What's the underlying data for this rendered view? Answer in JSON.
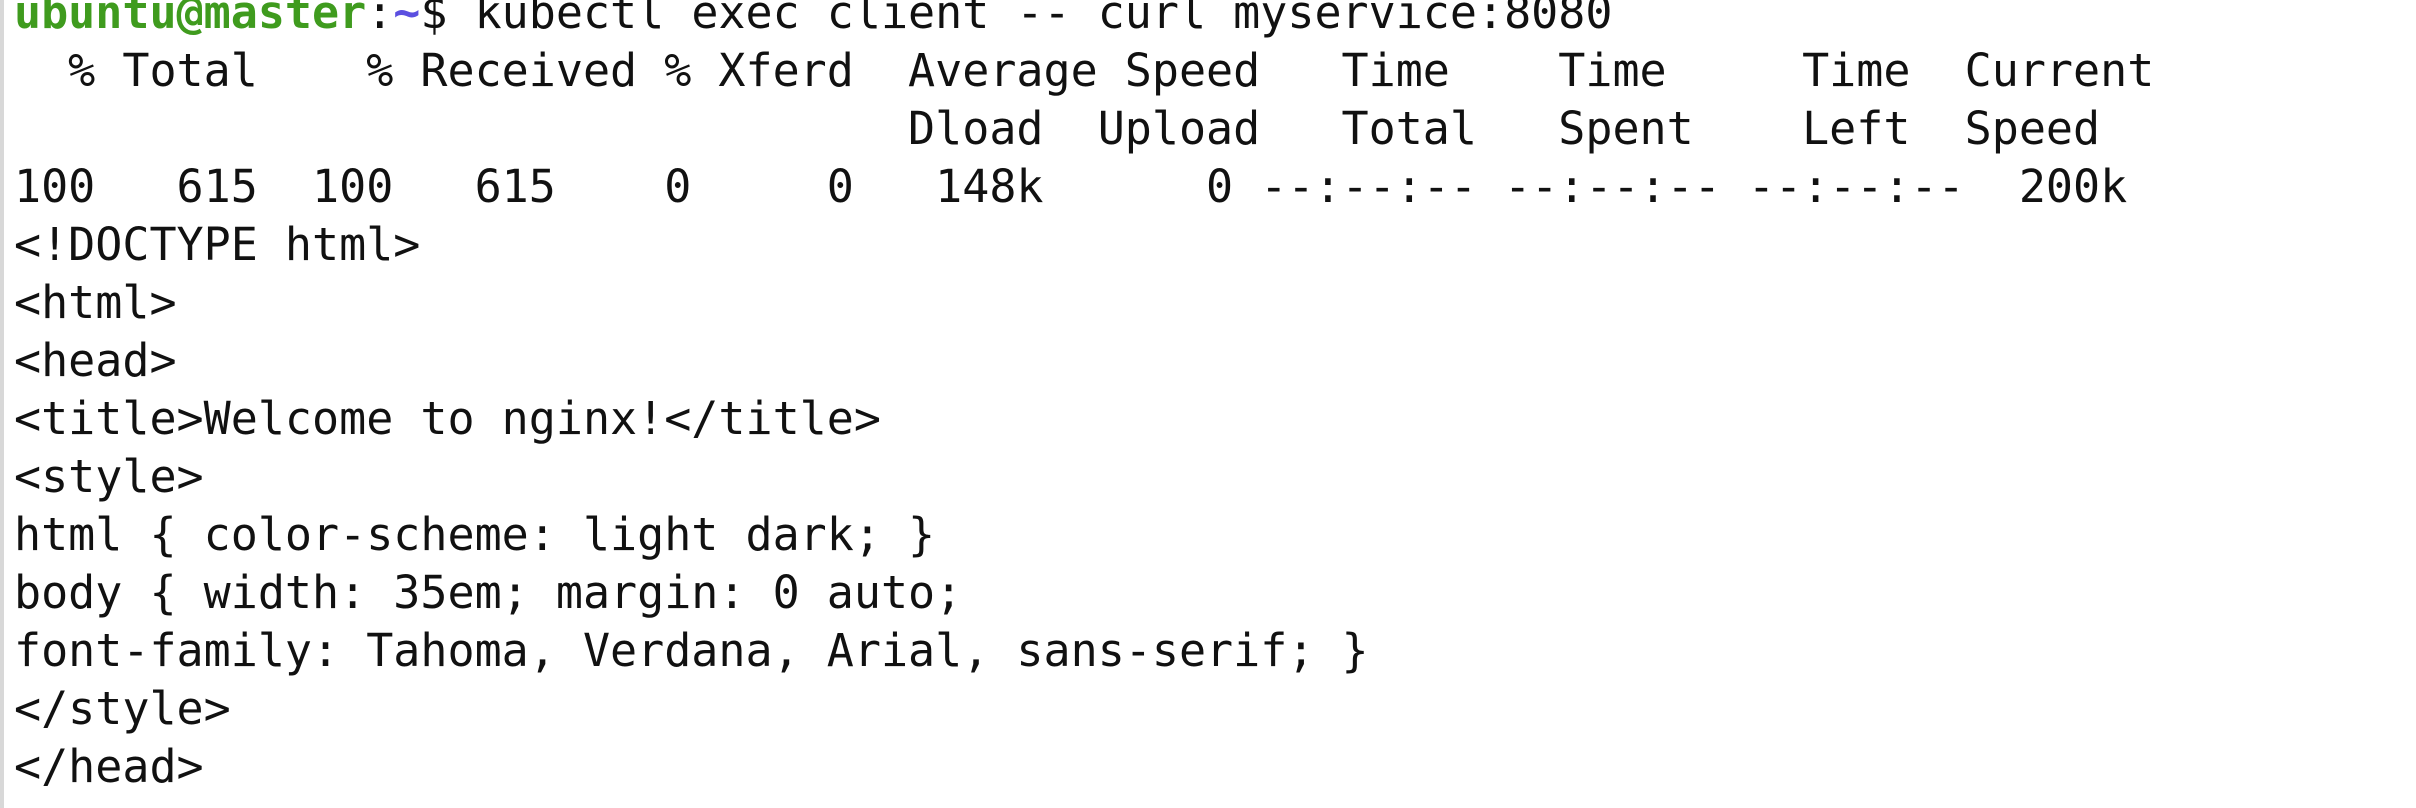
{
  "terminal": {
    "prompt": {
      "user_host": "ubuntu@master",
      "colon": ":",
      "path": "~",
      "dollar": "$",
      "command": " kubectl exec client -- curl myservice:8080"
    },
    "output_lines": [
      "  % Total    % Received % Xferd  Average Speed   Time    Time     Time  Current",
      "                                 Dload  Upload   Total   Spent    Left  Speed",
      "100   615  100   615    0     0   148k      0 --:--:-- --:--:-- --:--:--  200k",
      "<!DOCTYPE html>",
      "<html>",
      "<head>",
      "<title>Welcome to nginx!</title>",
      "<style>",
      "html { color-scheme: light dark; }",
      "body { width: 35em; margin: 0 auto;",
      "font-family: Tahoma, Verdana, Arial, sans-serif; }",
      "</style>",
      "</head>"
    ],
    "colors": {
      "user_host": "#3f9b1e",
      "path": "#5b4fe0",
      "text": "#111111",
      "background": "#ffffff"
    }
  }
}
